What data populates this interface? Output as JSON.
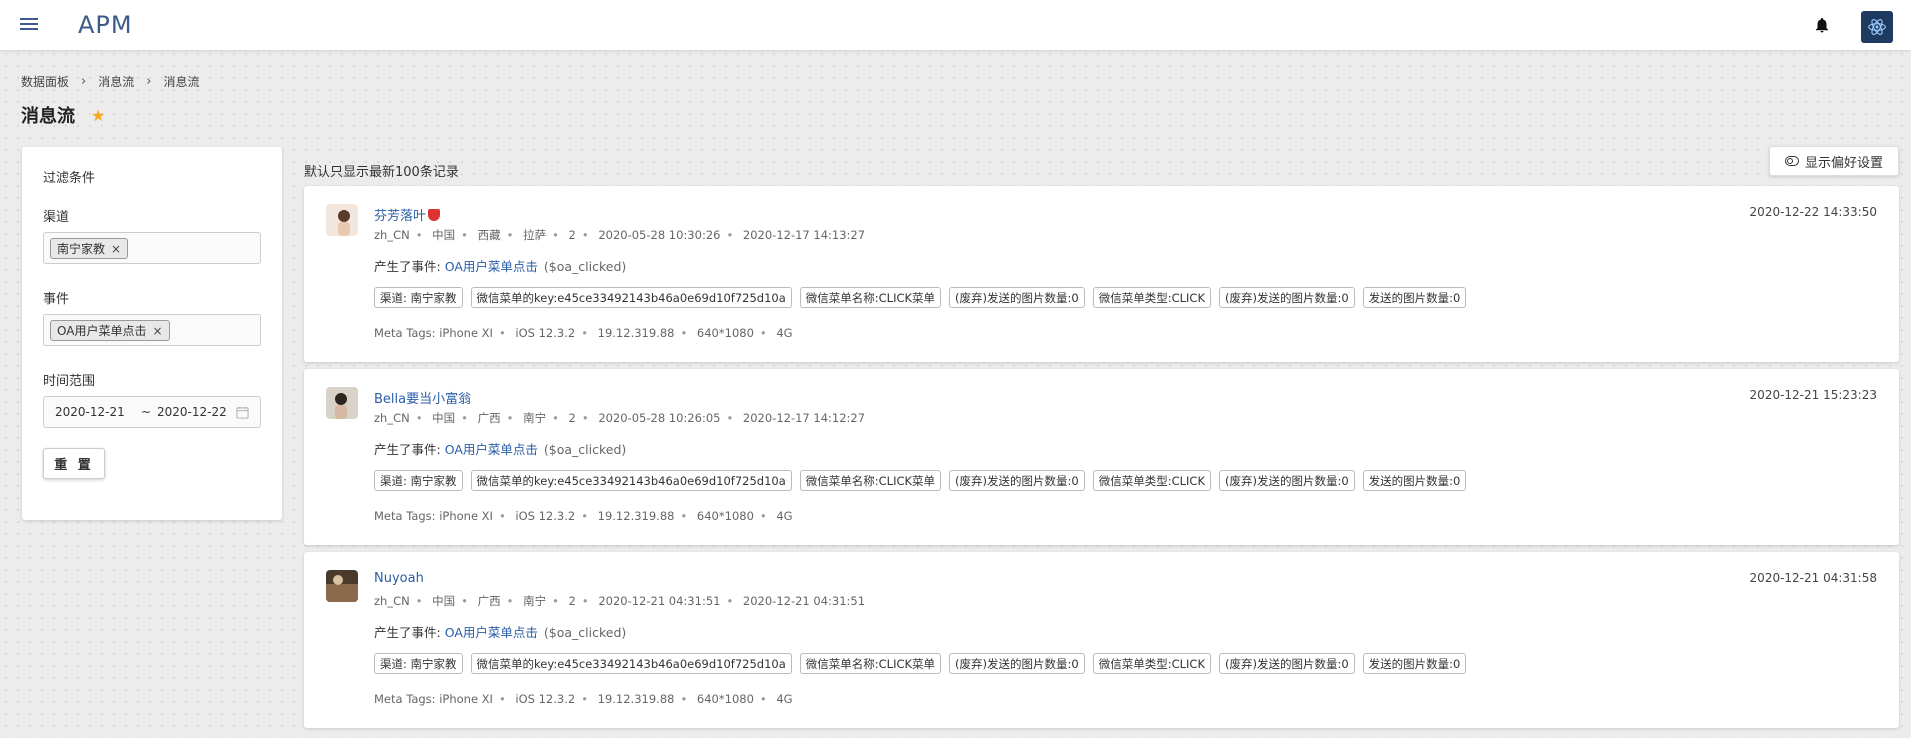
{
  "app": {
    "logo": "APM",
    "accent": "#3d5a8c"
  },
  "breadcrumb": [
    "数据面板",
    "消息流",
    "消息流"
  ],
  "page": {
    "title": "消息流"
  },
  "filters": {
    "title": "过滤条件",
    "channel_label": "渠道",
    "channel_value": "南宁家教",
    "event_label": "事件",
    "event_value": "OA用户菜单点击",
    "range_label": "时间范围",
    "range_start": "2020-12-21",
    "range_sep": "~",
    "range_end": "2020-12-22",
    "reset_label": "重 置"
  },
  "stream": {
    "note": "默认只显示最新100条记录",
    "pref_label": "显示偏好设置",
    "event_prefix": "产生了事件:",
    "meta_prefix": "Meta Tags:",
    "items": [
      {
        "name": "芬芳落叶",
        "timestamp": "2020-12-22 14:33:50",
        "meta": [
          "zh_CN",
          "中国",
          "西藏",
          "拉萨",
          "2",
          "2020-05-28 10:30:26",
          "2020-12-17 14:13:27"
        ],
        "event_name": "OA用户菜单点击",
        "event_code": "($oa_clicked)",
        "tags": [
          "渠道: 南宁家教",
          "微信菜单的key:e45ce33492143b46a0e69d10f725d10a",
          "微信菜单名称:CLICK菜单",
          "(废弃)发送的图片数量:0",
          "微信菜单类型:CLICK",
          "(废弃)发送的图片数量:0",
          "发送的图片数量:0"
        ],
        "meta_tags": [
          "iPhone XI",
          "iOS 12.3.2",
          "19.12.319.88",
          "640*1080",
          "4G"
        ]
      },
      {
        "name": "Bella要当小富翁",
        "timestamp": "2020-12-21 15:23:23",
        "meta": [
          "zh_CN",
          "中国",
          "广西",
          "南宁",
          "2",
          "2020-05-28 10:26:05",
          "2020-12-17 14:12:27"
        ],
        "event_name": "OA用户菜单点击",
        "event_code": "($oa_clicked)",
        "tags": [
          "渠道: 南宁家教",
          "微信菜单的key:e45ce33492143b46a0e69d10f725d10a",
          "微信菜单名称:CLICK菜单",
          "(废弃)发送的图片数量:0",
          "微信菜单类型:CLICK",
          "(废弃)发送的图片数量:0",
          "发送的图片数量:0"
        ],
        "meta_tags": [
          "iPhone XI",
          "iOS 12.3.2",
          "19.12.319.88",
          "640*1080",
          "4G"
        ]
      },
      {
        "name": "Nuyoah",
        "timestamp": "2020-12-21 04:31:58",
        "meta": [
          "zh_CN",
          "中国",
          "广西",
          "南宁",
          "2",
          "2020-12-21 04:31:51",
          "2020-12-21 04:31:51"
        ],
        "event_name": "OA用户菜单点击",
        "event_code": "($oa_clicked)",
        "tags": [
          "渠道: 南宁家教",
          "微信菜单的key:e45ce33492143b46a0e69d10f725d10a",
          "微信菜单名称:CLICK菜单",
          "(废弃)发送的图片数量:0",
          "微信菜单类型:CLICK",
          "(废弃)发送的图片数量:0",
          "发送的图片数量:0"
        ],
        "meta_tags": [
          "iPhone XI",
          "iOS 12.3.2",
          "19.12.319.88",
          "640*1080",
          "4G"
        ]
      }
    ]
  }
}
